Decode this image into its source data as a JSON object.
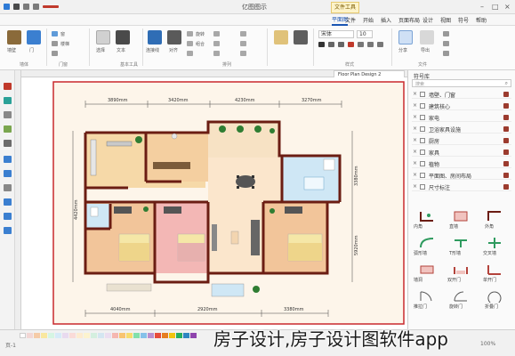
{
  "titlebar": {
    "window_title": "亿图图示",
    "context_tab": "文件工具"
  },
  "menu": {
    "tabs": [
      "文件",
      "开始",
      "插入",
      "页面布局",
      "设计",
      "视图",
      "符号",
      "帮助",
      "平面图"
    ],
    "active_index": 8
  },
  "ribbon": {
    "groups": [
      "墙体",
      "门窗",
      "结构",
      "基本工具",
      "排列",
      "样式",
      "文件"
    ],
    "buttons": [
      "墙壁",
      "门",
      "窗",
      "楼梯",
      "选择",
      "文本",
      "连接线",
      "对齐",
      "旋转",
      "组合",
      "字体",
      "格式刷",
      "分享",
      "导出"
    ],
    "font_size": "10",
    "font_name": "宋体"
  },
  "document": {
    "tab_label": "Floor Plan Design 2"
  },
  "plan": {
    "dim_top": [
      "3890mm",
      "3420mm",
      "4230mm",
      "3270mm"
    ],
    "dim_bottom": [
      "4040mm",
      "2920mm",
      "3380mm"
    ],
    "dim_left": "4420mm",
    "dim_right_upper": "3380mm",
    "dim_right_lower": "5920mm"
  },
  "right_panel": {
    "title": "符号库",
    "search_placeholder": "搜索",
    "categories": [
      "墙壁、门窗",
      "建筑核心",
      "家电",
      "卫浴家具设施",
      "厨房",
      "家具",
      "植物",
      "平面图、房间布局",
      "尺寸标注"
    ],
    "shapes": [
      {
        "label": "内角"
      },
      {
        "label": "直墙"
      },
      {
        "label": "外角"
      },
      {
        "label": "弧形墙"
      },
      {
        "label": "T形墙"
      },
      {
        "label": "交叉墙"
      },
      {
        "label": "墙洞"
      },
      {
        "label": "双开门"
      },
      {
        "label": "单开门"
      },
      {
        "label": "推拉门"
      },
      {
        "label": "旋转门"
      },
      {
        "label": "折叠门"
      }
    ]
  },
  "statusbar": {
    "page_label": "页-1",
    "zoom": "100%"
  },
  "caption": "房子设计,房子设计图软件app",
  "colors": {
    "wall": "#6b1d13",
    "floor_kitchen": "#f6d9a8",
    "floor_bedroom_pink": "#f3b7b5",
    "floor_bedroom": "#f2c59a",
    "floor_bath": "#cfe7f5",
    "floor_living": "#fbe6cc",
    "border_red": "#c9282d",
    "accent_blue": "#1a55b3"
  }
}
